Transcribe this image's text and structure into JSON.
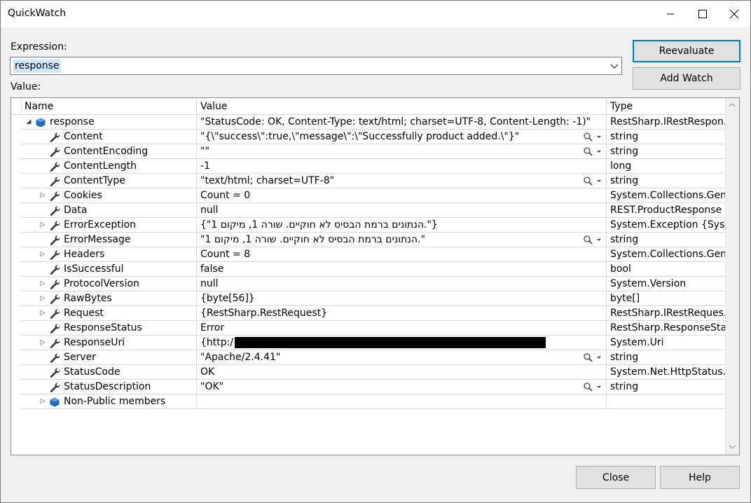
{
  "window": {
    "title": "QuickWatch"
  },
  "expression": {
    "label": "Expression:",
    "value": "response"
  },
  "value_label": "Value:",
  "buttons": {
    "reevaluate": "Reevaluate",
    "add_watch": "Add Watch",
    "close": "Close",
    "help": "Help"
  },
  "grid": {
    "headers": {
      "name": "Name",
      "value": "Value",
      "type": "Type"
    },
    "rows": [
      {
        "name": "response",
        "value": "\"StatusCode: OK, Content-Type: text/html; charset=UTF-8, Content-Length: -1)\"",
        "type": "RestSharp.IRestRespon...",
        "icon": "object-icon",
        "expander": "expanded",
        "level": 0,
        "magnifier": false
      },
      {
        "name": "Content",
        "value": "\"{\\\"success\\\":true,\\\"message\\\":\\\"Successfully product added.\\\"}\"",
        "type": "string",
        "icon": "wrench-icon",
        "expander": "none",
        "level": 1,
        "magnifier": true
      },
      {
        "name": "ContentEncoding",
        "value": "\"\"",
        "type": "string",
        "icon": "wrench-icon",
        "expander": "none",
        "level": 1,
        "magnifier": true
      },
      {
        "name": "ContentLength",
        "value": "-1",
        "type": "long",
        "icon": "wrench-icon",
        "expander": "none",
        "level": 1,
        "magnifier": false
      },
      {
        "name": "ContentType",
        "value": "\"text/html; charset=UTF-8\"",
        "type": "string",
        "icon": "wrench-icon",
        "expander": "none",
        "level": 1,
        "magnifier": true
      },
      {
        "name": "Cookies",
        "value": "Count = 0",
        "type": "System.Collections.Gen...",
        "icon": "wrench-icon",
        "expander": "collapsed",
        "level": 1,
        "magnifier": false
      },
      {
        "name": "Data",
        "value": "null",
        "type": "REST.ProductResponse",
        "icon": "wrench-icon",
        "expander": "none",
        "level": 1,
        "magnifier": false
      },
      {
        "name": "ErrorException",
        "value": "{\"הנתונים ברמת הבסיס לא חוקיים. שורה 1, מיקום 1.\"}",
        "type": "System.Exception {Syst...",
        "icon": "wrench-icon",
        "expander": "collapsed",
        "level": 1,
        "magnifier": false
      },
      {
        "name": "ErrorMessage",
        "value": "\"הנתונים ברמת הבסיס לא חוקיים. שורה 1, מיקום 1.\"",
        "type": "string",
        "icon": "wrench-icon",
        "expander": "none",
        "level": 1,
        "magnifier": true
      },
      {
        "name": "Headers",
        "value": "Count = 8",
        "type": "System.Collections.Gen...",
        "icon": "wrench-icon",
        "expander": "collapsed",
        "level": 1,
        "magnifier": false
      },
      {
        "name": "IsSuccessful",
        "value": "false",
        "type": "bool",
        "icon": "wrench-icon",
        "expander": "none",
        "level": 1,
        "magnifier": false
      },
      {
        "name": "ProtocolVersion",
        "value": "null",
        "type": "System.Version",
        "icon": "wrench-icon",
        "expander": "collapsed",
        "level": 1,
        "magnifier": false
      },
      {
        "name": "RawBytes",
        "value": "{byte[56]}",
        "type": "byte[]",
        "icon": "wrench-icon",
        "expander": "collapsed",
        "level": 1,
        "magnifier": false
      },
      {
        "name": "Request",
        "value": "{RestSharp.RestRequest}",
        "type": "RestSharp.IRestReques...",
        "icon": "wrench-icon",
        "expander": "collapsed",
        "level": 1,
        "magnifier": false
      },
      {
        "name": "ResponseStatus",
        "value": "Error",
        "type": "RestSharp.ResponseSta...",
        "icon": "wrench-icon",
        "expander": "none",
        "level": 1,
        "magnifier": false
      },
      {
        "name": "ResponseUri",
        "value": "{http:/",
        "type": "System.Uri",
        "icon": "wrench-icon",
        "expander": "collapsed",
        "level": 1,
        "magnifier": false,
        "redacted": true
      },
      {
        "name": "Server",
        "value": "\"Apache/2.4.41\"",
        "type": "string",
        "icon": "wrench-icon",
        "expander": "none",
        "level": 1,
        "magnifier": true
      },
      {
        "name": "StatusCode",
        "value": "OK",
        "type": "System.Net.HttpStatus...",
        "icon": "wrench-icon",
        "expander": "none",
        "level": 1,
        "magnifier": false
      },
      {
        "name": "StatusDescription",
        "value": "\"OK\"",
        "type": "string",
        "icon": "wrench-icon",
        "expander": "none",
        "level": 1,
        "magnifier": true
      },
      {
        "name": "Non-Public members",
        "value": "",
        "type": "",
        "icon": "object-icon",
        "expander": "collapsed",
        "level": 1,
        "magnifier": false
      }
    ]
  },
  "colors": {
    "accent": "#0078d7",
    "selection": "#cce8ff",
    "object_icon": "#1e6fbd"
  }
}
